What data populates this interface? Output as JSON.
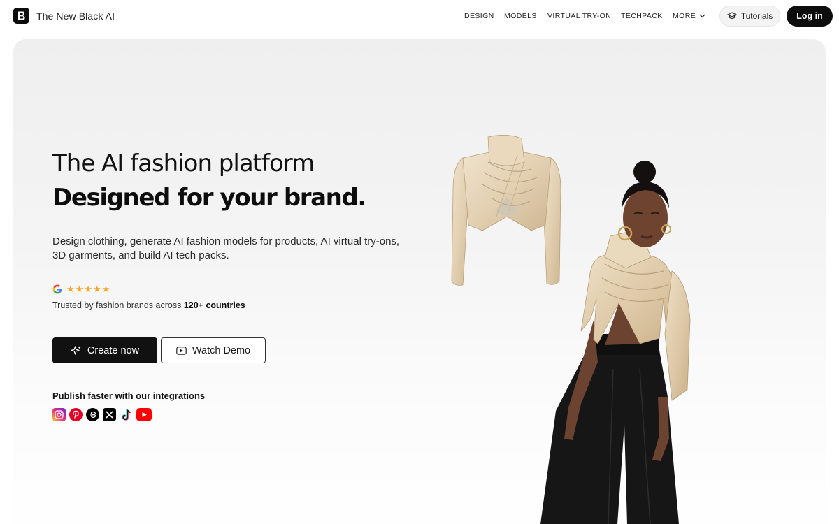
{
  "header": {
    "brand": "The New Black AI",
    "nav": [
      {
        "label": "DESIGN"
      },
      {
        "label": "MODELS"
      },
      {
        "label": "VIRTUAL TRY-ON"
      },
      {
        "label": "TECHPACK"
      },
      {
        "label": "MORE"
      }
    ],
    "tutorials_label": "Tutorials",
    "login_label": "Log in"
  },
  "hero": {
    "headline_light": "The AI fashion platform",
    "headline_bold": "Designed for your brand.",
    "lead": "Design clothing, generate AI fashion models for products, AI virtual try-ons, 3D garments, and build AI tech packs.",
    "rating_stars": "★★★★★",
    "trusted_prefix": "Trusted by fashion brands across ",
    "trusted_count": "120+ countries",
    "create_label": "Create now",
    "demo_label": "Watch Demo",
    "integrations_title": "Publish faster with our integrations",
    "integrations": [
      "instagram-icon",
      "pinterest-icon",
      "threads-icon",
      "x-icon",
      "tiktok-icon",
      "youtube-icon"
    ]
  },
  "colors": {
    "accent": "#0d0d0d",
    "star": "#f5a623",
    "hero_bg": "#efefef"
  }
}
